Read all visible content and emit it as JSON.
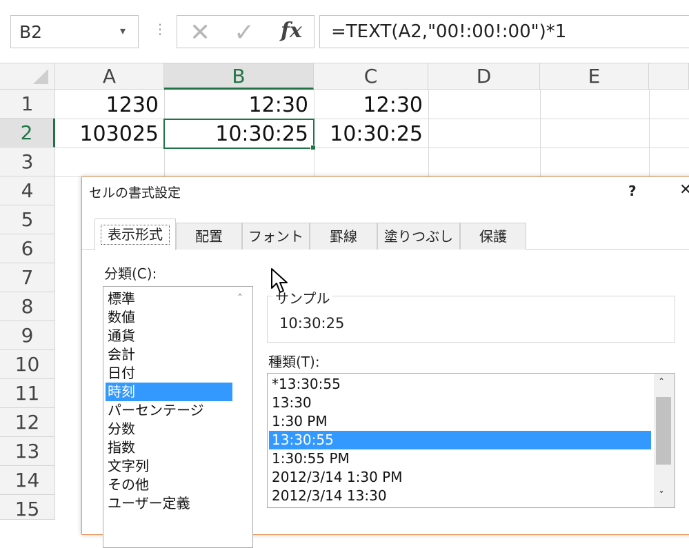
{
  "formula_bar": {
    "name_box": "B2",
    "name_box_arrow": "▾",
    "dots": "⋮",
    "cancel_glyph": "✕",
    "enter_glyph": "✓",
    "fx": "fx",
    "formula": "=TEXT(A2,\"00!:00!:00\")*1"
  },
  "columns": [
    "A",
    "B",
    "C",
    "D",
    "E"
  ],
  "rows": [
    "1",
    "2",
    "3",
    "4",
    "5",
    "6",
    "7",
    "8",
    "9",
    "10",
    "11",
    "12",
    "13",
    "14",
    "15"
  ],
  "cells": {
    "A1": "1230",
    "B1": "12:30",
    "C1": "12:30",
    "A2": "103025",
    "B2": "10:30:25",
    "C2": "10:30:25"
  },
  "selected": {
    "column": "B",
    "row": "2"
  },
  "dialog": {
    "title": "セルの書式設定",
    "help": "?",
    "close": "✕",
    "tabs": [
      "表示形式",
      "配置",
      "フォント",
      "罫線",
      "塗りつぶし",
      "保護"
    ],
    "active_tab": "表示形式",
    "category_label": "分類(C):",
    "categories": [
      "標準",
      "数値",
      "通貨",
      "会計",
      "日付",
      "時刻",
      "パーセンテージ",
      "分数",
      "指数",
      "文字列",
      "その他",
      "ユーザー定義"
    ],
    "selected_category": "時刻",
    "sample_label": "サンプル",
    "sample_value": "10:30:25",
    "type_label": "種類(T):",
    "types": [
      "*13:30:55",
      "13:30",
      "1:30 PM",
      "13:30:55",
      "1:30:55 PM",
      "2012/3/14 1:30 PM",
      "2012/3/14 13:30"
    ],
    "selected_type": "13:30:55",
    "scroll_up": "ˆ",
    "scroll_down": "ˇ"
  },
  "colors": {
    "accent": "#217346",
    "selection": "#3399ff",
    "dialog_border": "#e59a5d"
  }
}
